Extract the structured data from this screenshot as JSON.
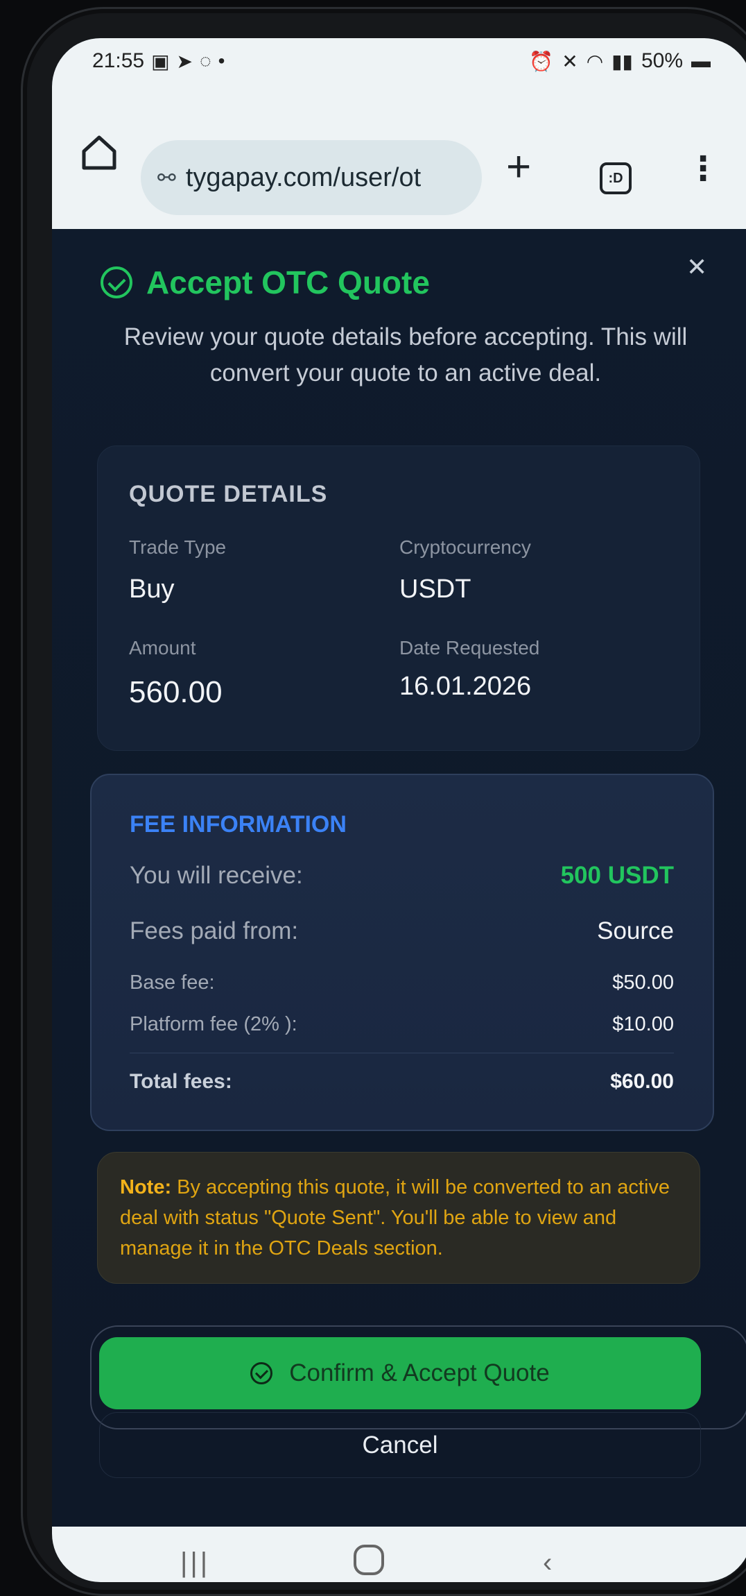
{
  "status_bar": {
    "time": "21:55",
    "left_icons": [
      "gallery-icon",
      "telegram-icon",
      "whatsapp-icon",
      "dot"
    ],
    "battery": "50%"
  },
  "browser": {
    "url": "tygapay.com/user/ot",
    "tab_label": ":D"
  },
  "modal": {
    "title": "Accept OTC Quote",
    "subtitle": "Review your quote details before accepting. This will convert your quote to an active deal.",
    "quote_details": {
      "heading": "QUOTE DETAILS",
      "trade_type_label": "Trade Type",
      "trade_type": "Buy",
      "crypto_label": "Cryptocurrency",
      "crypto": "USDT",
      "amount_label": "Amount",
      "amount": "560.00",
      "date_label": "Date Requested",
      "date": "16.01.2026"
    },
    "fee_info": {
      "heading": "FEE INFORMATION",
      "receive_label": "You will receive:",
      "receive_value": "500 USDT",
      "paid_from_label": "Fees paid from:",
      "paid_from_value": "Source",
      "base_fee_label": "Base fee:",
      "base_fee_value": "$50.00",
      "platform_fee_label": "Platform fee (2% ):",
      "platform_fee_value": "$10.00",
      "total_label": "Total fees:",
      "total_value": "$60.00"
    },
    "note": {
      "prefix": "Note:",
      "text": " By accepting this quote, it will be converted to an active deal with status \"Quote Sent\". You'll be able to view and manage it in the OTC Deals section."
    },
    "confirm_label": "Confirm & Accept Quote",
    "cancel_label": "Cancel"
  },
  "colors": {
    "accent_green": "#22c55e",
    "accent_blue": "#3b82f6",
    "note_amber": "#e0a512",
    "modal_bg": "#0f1b2c"
  }
}
